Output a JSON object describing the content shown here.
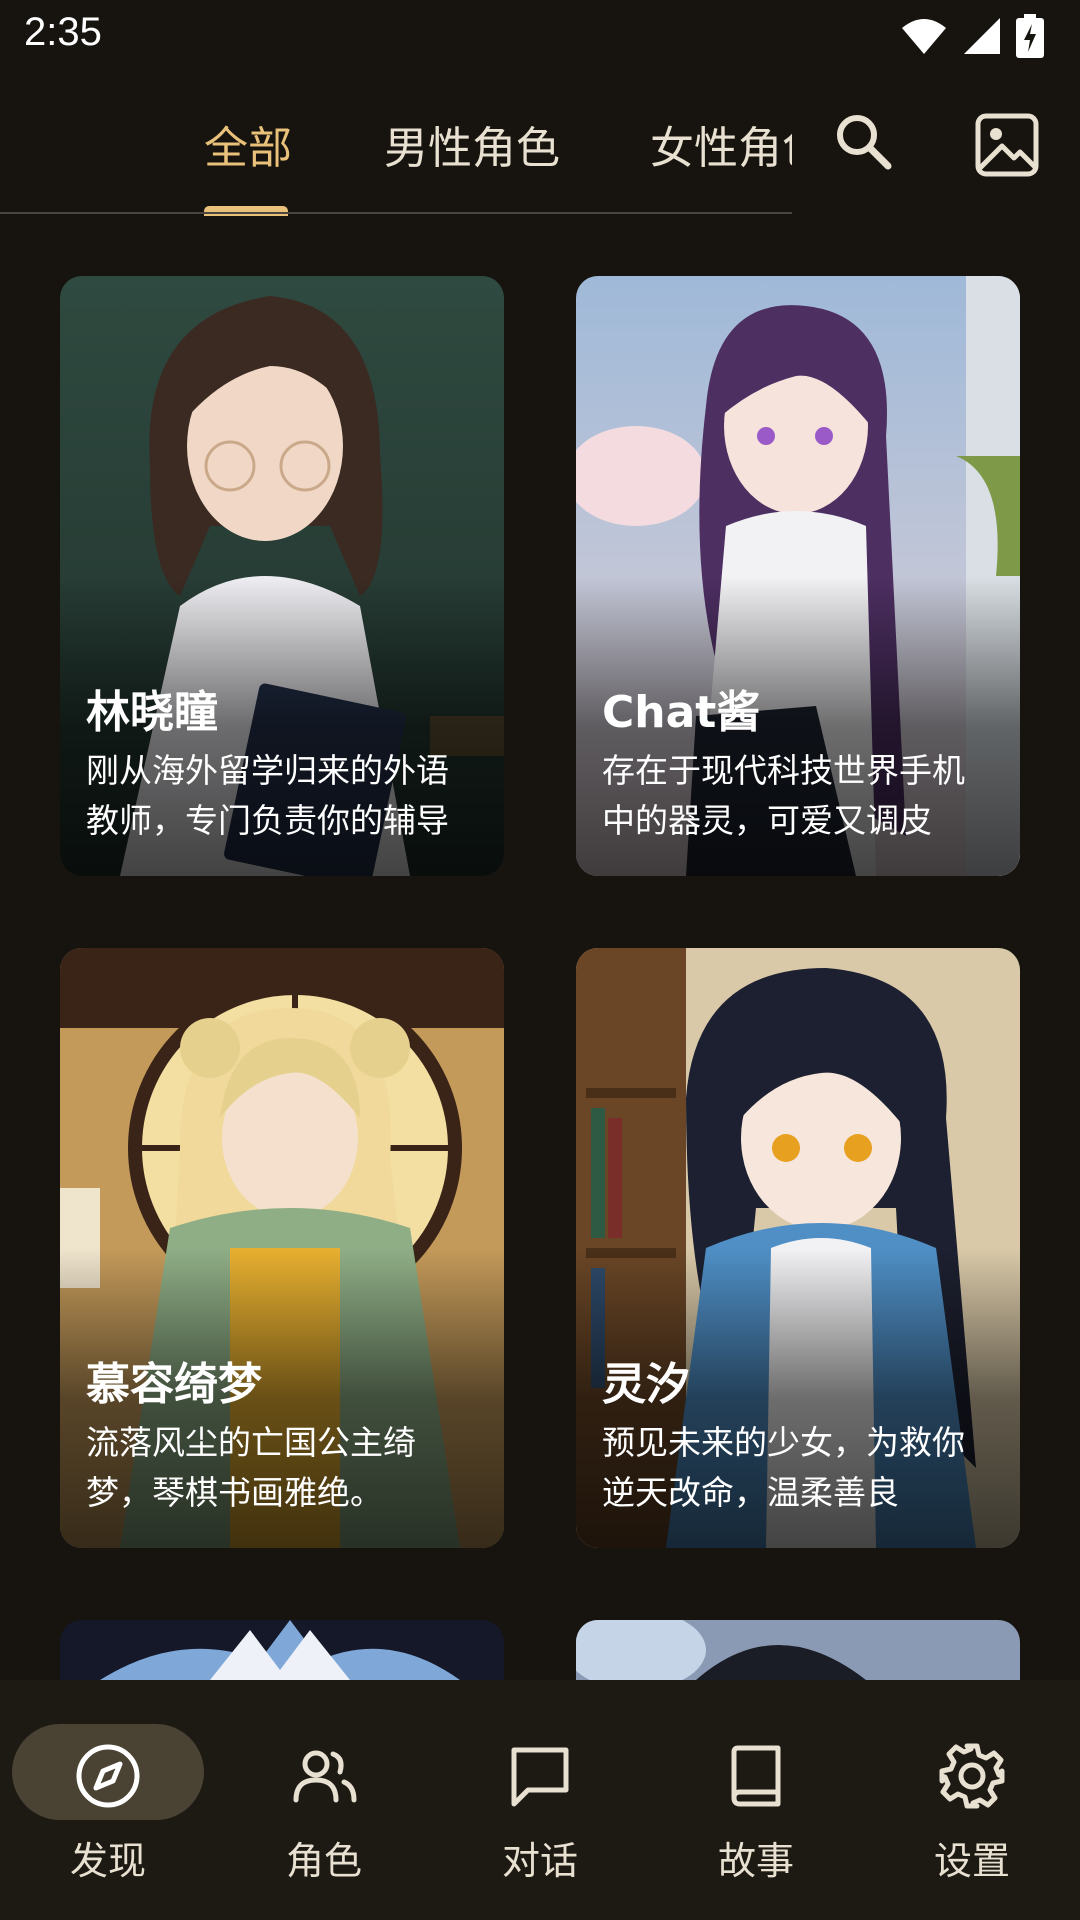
{
  "status_bar": {
    "time": "2:35"
  },
  "tabs": [
    {
      "label": "全部",
      "active": true
    },
    {
      "label": "男性角色",
      "active": false
    },
    {
      "label": "女性角色",
      "active": false
    }
  ],
  "header_icons": {
    "search": "search-icon",
    "image": "image-icon"
  },
  "colors": {
    "accent": "#e9c17a",
    "background": "#17140f",
    "nav_pill": "#4a4232"
  },
  "cards": [
    {
      "name": "林晓瞳",
      "description": "刚从海外留学归来的外语教师，专门负责你的辅导"
    },
    {
      "name": "Chat酱",
      "description": "存在于现代科技世界手机中的器灵，可爱又调皮"
    },
    {
      "name": "慕容绮梦",
      "description": "流落风尘的亡国公主绮梦，琴棋书画雅绝。"
    },
    {
      "name": "灵汐",
      "description": "预见未来的少女，为救你逆天改命，温柔善良"
    }
  ],
  "bottom_nav": [
    {
      "label": "发现",
      "icon": "compass-icon",
      "active": true
    },
    {
      "label": "角色",
      "icon": "users-icon",
      "active": false
    },
    {
      "label": "对话",
      "icon": "chat-bubble-icon",
      "active": false
    },
    {
      "label": "故事",
      "icon": "book-icon",
      "active": false
    },
    {
      "label": "设置",
      "icon": "gear-icon",
      "active": false
    }
  ]
}
